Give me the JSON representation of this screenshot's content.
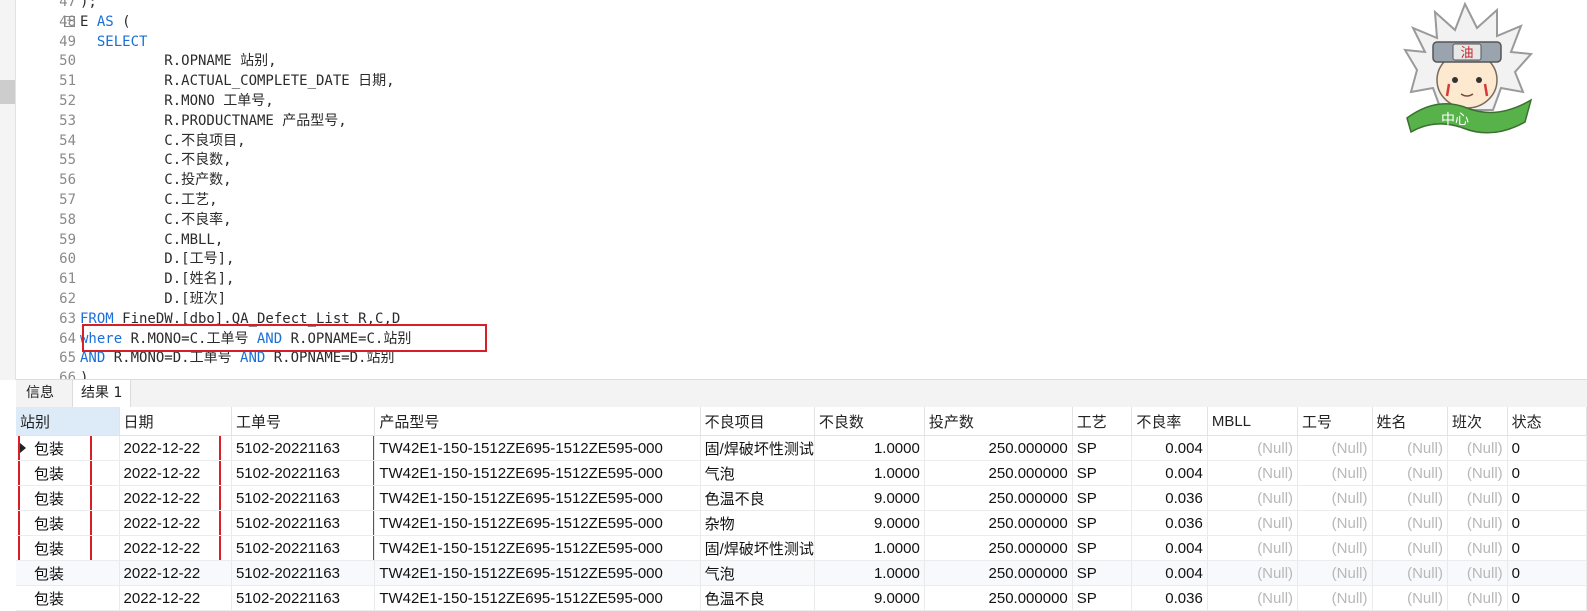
{
  "editor": {
    "lines": [
      {
        "num": "47",
        "segments": [
          {
            "t": ");",
            "kw": false
          }
        ]
      },
      {
        "num": "48",
        "fold": true,
        "segments": [
          {
            "t": "E ",
            "kw": false
          },
          {
            "t": "AS",
            "kw": true
          },
          {
            "t": " (",
            "kw": false
          }
        ]
      },
      {
        "num": "49",
        "segments": [
          {
            "t": "  ",
            "kw": false
          },
          {
            "t": "SELECT",
            "kw": true
          }
        ]
      },
      {
        "num": "50",
        "segments": [
          {
            "t": "          R.OPNAME 站别,",
            "kw": false
          }
        ]
      },
      {
        "num": "51",
        "segments": [
          {
            "t": "          R.ACTUAL_COMPLETE_DATE 日期,",
            "kw": false
          }
        ]
      },
      {
        "num": "52",
        "segments": [
          {
            "t": "          R.MONO 工单号,",
            "kw": false
          }
        ]
      },
      {
        "num": "53",
        "segments": [
          {
            "t": "          R.PRODUCTNAME 产品型号,",
            "kw": false
          }
        ]
      },
      {
        "num": "54",
        "segments": [
          {
            "t": "          C.不良项目,",
            "kw": false
          }
        ]
      },
      {
        "num": "55",
        "segments": [
          {
            "t": "          C.不良数,",
            "kw": false
          }
        ]
      },
      {
        "num": "56",
        "segments": [
          {
            "t": "          C.投产数,",
            "kw": false
          }
        ]
      },
      {
        "num": "57",
        "segments": [
          {
            "t": "          C.工艺,",
            "kw": false
          }
        ]
      },
      {
        "num": "58",
        "segments": [
          {
            "t": "          C.不良率,",
            "kw": false
          }
        ]
      },
      {
        "num": "59",
        "segments": [
          {
            "t": "          C.MBLL,",
            "kw": false
          }
        ]
      },
      {
        "num": "60",
        "segments": [
          {
            "t": "          D.[工号],",
            "kw": false
          }
        ]
      },
      {
        "num": "61",
        "segments": [
          {
            "t": "          D.[姓名],",
            "kw": false
          }
        ]
      },
      {
        "num": "62",
        "segments": [
          {
            "t": "          D.[班次]",
            "kw": false
          }
        ]
      },
      {
        "num": "63",
        "segments": [
          {
            "t": "FROM",
            "kw": true
          },
          {
            "t": " FineDW.[dbo].QA_Defect_List R,C,D",
            "kw": false
          }
        ]
      },
      {
        "num": "64",
        "segments": [
          {
            "t": "where",
            "kw": true
          },
          {
            "t": " R.MONO=C.工单号 ",
            "kw": false
          },
          {
            "t": "AND",
            "kw": true
          },
          {
            "t": " R.OPNAME=C.站别",
            "kw": false
          }
        ]
      },
      {
        "num": "65",
        "segments": [
          {
            "t": "AND",
            "kw": true
          },
          {
            "t": " R.MONO=D.工单号 ",
            "kw": false
          },
          {
            "t": "AND",
            "kw": true
          },
          {
            "t": " R.OPNAME=D.站别",
            "kw": false
          }
        ]
      },
      {
        "num": "66",
        "segments": [
          {
            "t": ")",
            "kw": false
          }
        ]
      }
    ]
  },
  "tabs": [
    {
      "label": "信息",
      "active": false
    },
    {
      "label": "结果 1",
      "active": true
    }
  ],
  "result_grid": {
    "columns": [
      "站别",
      "日期",
      "工单号",
      "产品型号",
      "不良项目",
      "不良数",
      "投产数",
      "工艺",
      "不良率",
      "MBLL",
      "工号",
      "姓名",
      "班次",
      "状态"
    ],
    "rows": [
      [
        "包装",
        "2022-12-22",
        "5102-20221163",
        "TW42E1-150-1512ZE695-1512ZE595-000",
        "固/焊破坏性测试",
        "1.0000",
        "250.000000",
        "SP",
        "0.004",
        "(Null)",
        "(Null)",
        "(Null)",
        "(Null)",
        "0"
      ],
      [
        "包装",
        "2022-12-22",
        "5102-20221163",
        "TW42E1-150-1512ZE695-1512ZE595-000",
        "气泡",
        "1.0000",
        "250.000000",
        "SP",
        "0.004",
        "(Null)",
        "(Null)",
        "(Null)",
        "(Null)",
        "0"
      ],
      [
        "包装",
        "2022-12-22",
        "5102-20221163",
        "TW42E1-150-1512ZE695-1512ZE595-000",
        "色温不良",
        "9.0000",
        "250.000000",
        "SP",
        "0.036",
        "(Null)",
        "(Null)",
        "(Null)",
        "(Null)",
        "0"
      ],
      [
        "包装",
        "2022-12-22",
        "5102-20221163",
        "TW42E1-150-1512ZE695-1512ZE595-000",
        "杂物",
        "9.0000",
        "250.000000",
        "SP",
        "0.036",
        "(Null)",
        "(Null)",
        "(Null)",
        "(Null)",
        "0"
      ],
      [
        "包装",
        "2022-12-22",
        "5102-20221163",
        "TW42E1-150-1512ZE695-1512ZE595-000",
        "固/焊破坏性测试",
        "1.0000",
        "250.000000",
        "SP",
        "0.004",
        "(Null)",
        "(Null)",
        "(Null)",
        "(Null)",
        "0"
      ],
      [
        "包装",
        "2022-12-22",
        "5102-20221163",
        "TW42E1-150-1512ZE695-1512ZE595-000",
        "气泡",
        "1.0000",
        "250.000000",
        "SP",
        "0.004",
        "(Null)",
        "(Null)",
        "(Null)",
        "(Null)",
        "0"
      ],
      [
        "包装",
        "2022-12-22",
        "5102-20221163",
        "TW42E1-150-1512ZE695-1512ZE595-000",
        "色温不良",
        "9.0000",
        "250.000000",
        "SP",
        "0.036",
        "(Null)",
        "(Null)",
        "(Null)",
        "(Null)",
        "0"
      ]
    ]
  },
  "mascot": {
    "headband_char": "油",
    "banner_text": "中心"
  },
  "colors": {
    "keyword": "#1a6fd8",
    "highlight": "#d81e27",
    "selected_header": "#ddebf8"
  }
}
